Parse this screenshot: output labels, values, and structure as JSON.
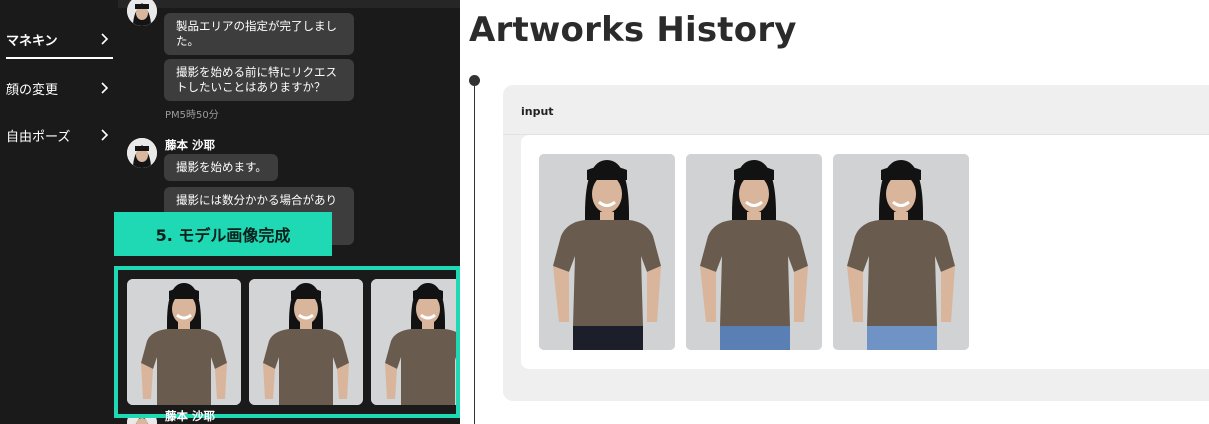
{
  "sidebar": {
    "items": [
      {
        "label": "マネキン",
        "active": true
      },
      {
        "label": "顔の変更"
      },
      {
        "label": "自由ポーズ"
      }
    ]
  },
  "chat": {
    "msg1": "製品エリアの指定が完了しました。",
    "msg2": "撮影を始める前に特にリクエストしたいことはありますか？",
    "time1": "PM5時50分",
    "sender": "藤本 沙耶",
    "msg3": "撮影を始めます。",
    "msg4": "撮影には数分かかる場合があり",
    "sender2": "藤本 沙耶"
  },
  "callout": "5. モデル画像完成",
  "history": {
    "title": "Artworks History",
    "card_label": "input"
  },
  "colors": {
    "accent": "#1fd8b4",
    "dark_bg": "#1a1a1a",
    "bubble": "#3d3d3d",
    "shirt": "#6a5b4f"
  }
}
